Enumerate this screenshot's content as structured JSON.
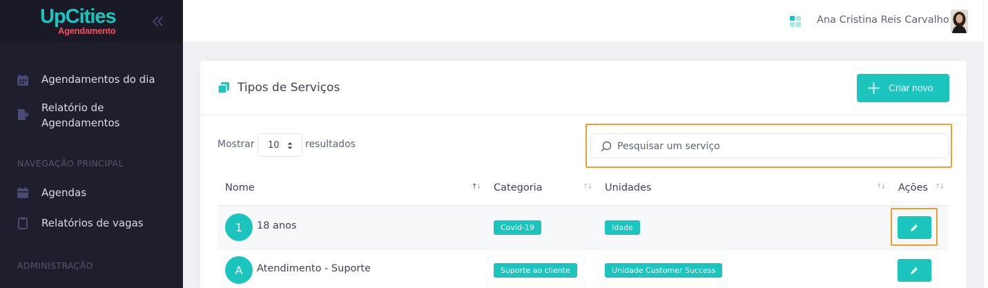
{
  "brand": {
    "name": "UpCities",
    "subtitle": "Agendamento"
  },
  "sidebar": {
    "items": [
      {
        "label": "Agendamentos do dia",
        "icon": "calendar-icon"
      },
      {
        "label": "Relatório de Agendamentos",
        "icon": "file-export-icon"
      }
    ],
    "section_main": "NAVEGAÇÃO PRINCIPAL",
    "main_items": [
      {
        "label": "Agendas",
        "icon": "calendar-icon"
      },
      {
        "label": "Relatórios de vagas",
        "icon": "clipboard-icon"
      }
    ],
    "section_admin": "ADMINISTRAÇÃO"
  },
  "header": {
    "user_name": "Ana Cristina Reis Carvalho"
  },
  "card": {
    "title": "Tipos de Serviços",
    "create_label": "Criar novo",
    "show_label": "Mostrar",
    "page_size": "10",
    "results_label": "resultados",
    "search_placeholder": "Pesquisar um serviço"
  },
  "table": {
    "columns": [
      "Nome",
      "Categoria",
      "Unidades",
      "Ações"
    ],
    "rows": [
      {
        "initial": "1",
        "name": "18 anos",
        "category": "Covid-19",
        "unit": "Idade"
      },
      {
        "initial": "A",
        "name": "Atendimento - Suporte",
        "category": "Suporte ao cliente",
        "unit": "Unidade Customer Success"
      }
    ]
  },
  "colors": {
    "accent": "#1bc5bd",
    "sidebar": "#1e1e2d",
    "highlight": "#f39c2c",
    "brand_secondary": "#f64e60"
  }
}
